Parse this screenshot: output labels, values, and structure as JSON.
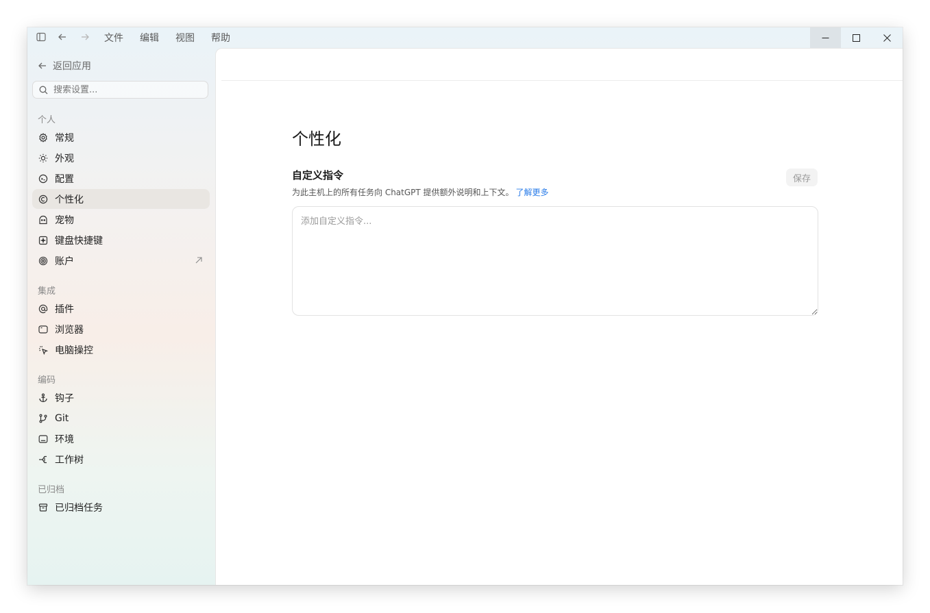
{
  "menu": {
    "items": [
      "文件",
      "编辑",
      "视图",
      "帮助"
    ]
  },
  "sidebar": {
    "back_label": "返回应用",
    "search_placeholder": "搜索设置...",
    "sections": [
      {
        "title": "个人",
        "items": [
          {
            "label": "常规",
            "icon": "gear-icon"
          },
          {
            "label": "外观",
            "icon": "sun-icon"
          },
          {
            "label": "配置",
            "icon": "config-icon"
          },
          {
            "label": "个性化",
            "icon": "personalize-icon",
            "active": true
          },
          {
            "label": "宠物",
            "icon": "pet-icon"
          },
          {
            "label": "键盘快捷键",
            "icon": "keyboard-icon"
          },
          {
            "label": "账户",
            "icon": "openai-icon",
            "external": true
          }
        ]
      },
      {
        "title": "集成",
        "items": [
          {
            "label": "插件",
            "icon": "at-icon"
          },
          {
            "label": "浏览器",
            "icon": "browser-icon"
          },
          {
            "label": "电脑操控",
            "icon": "cursor-sparkle-icon"
          }
        ]
      },
      {
        "title": "编码",
        "items": [
          {
            "label": "钩子",
            "icon": "anchor-icon"
          },
          {
            "label": "Git",
            "icon": "git-branch-icon"
          },
          {
            "label": "环境",
            "icon": "terminal-icon"
          },
          {
            "label": "工作树",
            "icon": "worktree-icon"
          }
        ]
      },
      {
        "title": "已归档",
        "items": [
          {
            "label": "已归档任务",
            "icon": "archive-icon"
          }
        ]
      }
    ]
  },
  "main": {
    "title": "个性化",
    "section_heading": "自定义指令",
    "description": "为此主机上的所有任务向 ChatGPT 提供额外说明和上下文。",
    "learn_more": "了解更多",
    "save_label": "保存",
    "textarea_placeholder": "添加自定义指令...",
    "textarea_value": ""
  },
  "colors": {
    "accent_link": "#2b7de9",
    "active_item_bg": "#e9e6e2"
  }
}
